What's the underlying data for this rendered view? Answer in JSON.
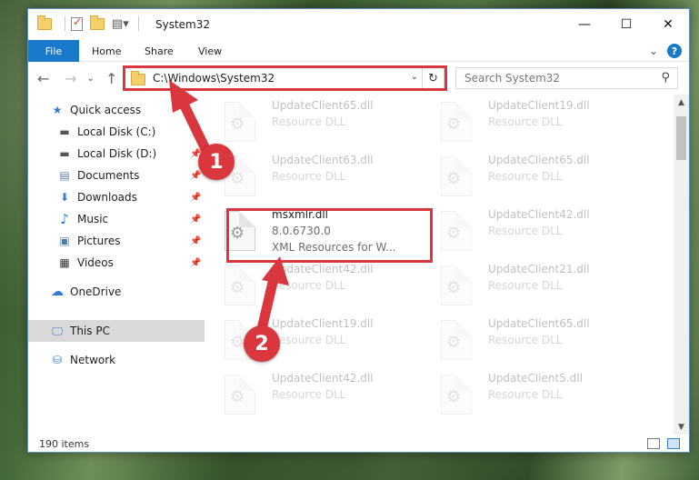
{
  "window": {
    "title": "System32",
    "minimize_glyph": "—",
    "maximize_glyph": "☐",
    "close_glyph": "✕"
  },
  "ribbon": {
    "file": "File",
    "home": "Home",
    "share": "Share",
    "view": "View",
    "expand_glyph": "⌄",
    "help_glyph": "?"
  },
  "nav": {
    "back_glyph": "←",
    "forward_glyph": "→",
    "recent_glyph": "⌄",
    "up_glyph": "↑",
    "address_path": "C:\\Windows\\System32",
    "address_dropdown_glyph": "⌄",
    "refresh_glyph": "↻",
    "search_placeholder": "Search System32",
    "search_glyph": "⚲"
  },
  "sidebar": {
    "items": [
      {
        "label": "Quick access",
        "icon": "star-icon",
        "glyph": "★",
        "color": "#2f7ad6"
      },
      {
        "label": "Local Disk (C:)",
        "icon": "drive-icon",
        "glyph": "▬",
        "color": "#555555"
      },
      {
        "label": "Local Disk (D:)",
        "icon": "drive-icon",
        "glyph": "▬",
        "color": "#555555"
      },
      {
        "label": "Documents",
        "icon": "documents-icon",
        "glyph": "▤",
        "color": "#5a7fa8"
      },
      {
        "label": "Downloads",
        "icon": "download-icon",
        "glyph": "⬇",
        "color": "#2f7ad6"
      },
      {
        "label": "Music",
        "icon": "music-icon",
        "glyph": "♪",
        "color": "#2f7ad6"
      },
      {
        "label": "Pictures",
        "icon": "pictures-icon",
        "glyph": "▣",
        "color": "#4a7aa8"
      },
      {
        "label": "Videos",
        "icon": "videos-icon",
        "glyph": "▦",
        "color": "#333333"
      },
      {
        "label": "OneDrive",
        "icon": "cloud-icon",
        "glyph": "☁",
        "color": "#2f7ad6"
      },
      {
        "label": "This PC",
        "icon": "computer-icon",
        "glyph": "🖵",
        "color": "#2f7ad6"
      },
      {
        "label": "Network",
        "icon": "network-icon",
        "glyph": "⛁",
        "color": "#2f7ad6"
      }
    ],
    "pin_glyph": "📌"
  },
  "files": [
    {
      "name": "UpdateClient65.dll",
      "desc": "Resource DLL"
    },
    {
      "name": "UpdateClient19.dll",
      "desc": "Resource DLL"
    },
    {
      "name": "UpdateClient63.dll",
      "desc": "Resource DLL"
    },
    {
      "name": "UpdateClient65.dll",
      "desc": "Resource DLL"
    },
    {
      "name": "msxmlr.dll",
      "version": "8.0.6730.0",
      "desc": "XML Resources for W..."
    },
    {
      "name": "UpdateClient42.dll",
      "desc": "Resource DLL"
    },
    {
      "name": "UpdateClient42.dll",
      "desc": "Resource DLL"
    },
    {
      "name": "UpdateClient21.dll",
      "desc": "Resource DLL"
    },
    {
      "name": "UpdateClient19.dll",
      "desc": "Resource DLL"
    },
    {
      "name": "UpdateClient65.dll",
      "desc": "Resource DLL"
    },
    {
      "name": "UpdateClient42.dll",
      "desc": "Resource DLL"
    },
    {
      "name": "UpdateClient5.dll",
      "desc": "Resource DLL"
    }
  ],
  "status": {
    "item_count": "190 items"
  },
  "annotations": {
    "step1": "1",
    "step2": "2",
    "highlight_color": "#d9363e"
  }
}
